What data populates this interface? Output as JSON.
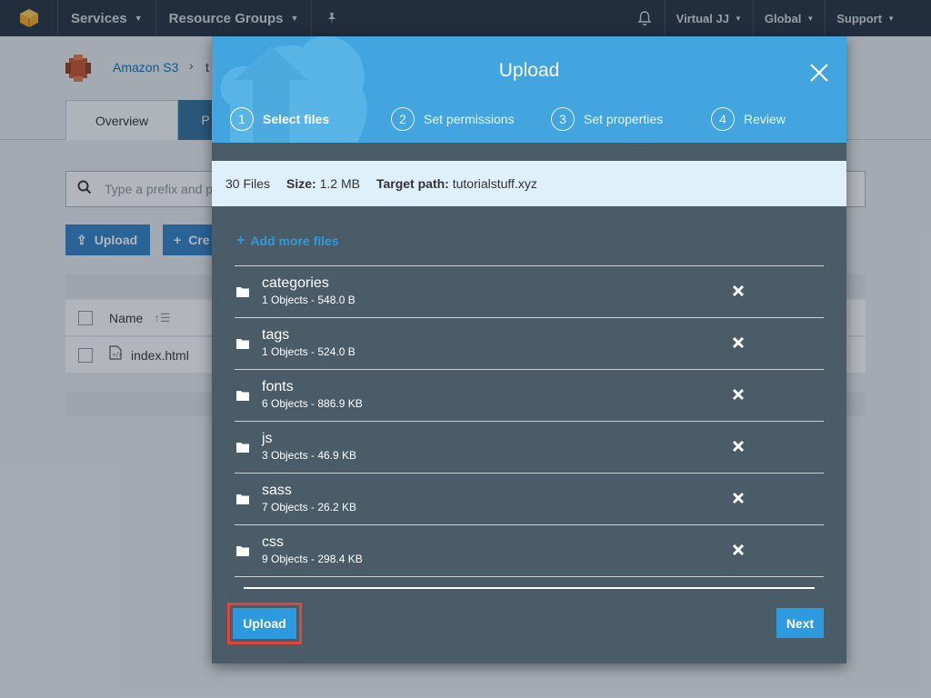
{
  "topnav": {
    "services_label": "Services",
    "resource_groups_label": "Resource Groups",
    "account_label": "Virtual JJ",
    "region_label": "Global",
    "support_label": "Support"
  },
  "background": {
    "breadcrumb_root": "Amazon S3",
    "breadcrumb_rest": "t",
    "tab_overview": "Overview",
    "tab_other": "P",
    "search_placeholder": "Type a prefix and p",
    "upload_button": "Upload",
    "create_button": "Cre",
    "column_name": "Name",
    "rows": [
      {
        "name": "index.html"
      }
    ]
  },
  "modal": {
    "title": "Upload",
    "steps": [
      {
        "num": "1",
        "label": "Select files"
      },
      {
        "num": "2",
        "label": "Set permissions"
      },
      {
        "num": "3",
        "label": "Set properties"
      },
      {
        "num": "4",
        "label": "Review"
      }
    ],
    "info": {
      "files_count": "30 Files",
      "size_label": "Size:",
      "size_value": "1.2 MB",
      "target_label": "Target path:",
      "target_value": "tutorialstuff.xyz"
    },
    "add_more_label": "Add more files",
    "files": [
      {
        "name": "categories",
        "meta": "1 Objects - 548.0 B"
      },
      {
        "name": "tags",
        "meta": "1 Objects - 524.0 B"
      },
      {
        "name": "fonts",
        "meta": "6 Objects - 886.9 KB"
      },
      {
        "name": "js",
        "meta": "3 Objects - 46.9 KB"
      },
      {
        "name": "sass",
        "meta": "7 Objects - 26.2 KB"
      },
      {
        "name": "css",
        "meta": "9 Objects - 298.4 KB"
      }
    ],
    "upload_button": "Upload",
    "next_button": "Next"
  },
  "colors": {
    "nav_bg": "#232f3e",
    "modal_header": "#42a5e0",
    "modal_body": "#4a5c68",
    "info_bar": "#def0fa",
    "primary_button": "#2d9ae0",
    "highlight_border": "#e0463a"
  },
  "icons": [
    "aws-logo-icon",
    "pin-icon",
    "bell-icon",
    "s3-icon",
    "search-icon",
    "upload-icon",
    "close-icon",
    "folder-icon",
    "remove-icon",
    "sort-icon",
    "file-icon"
  ]
}
